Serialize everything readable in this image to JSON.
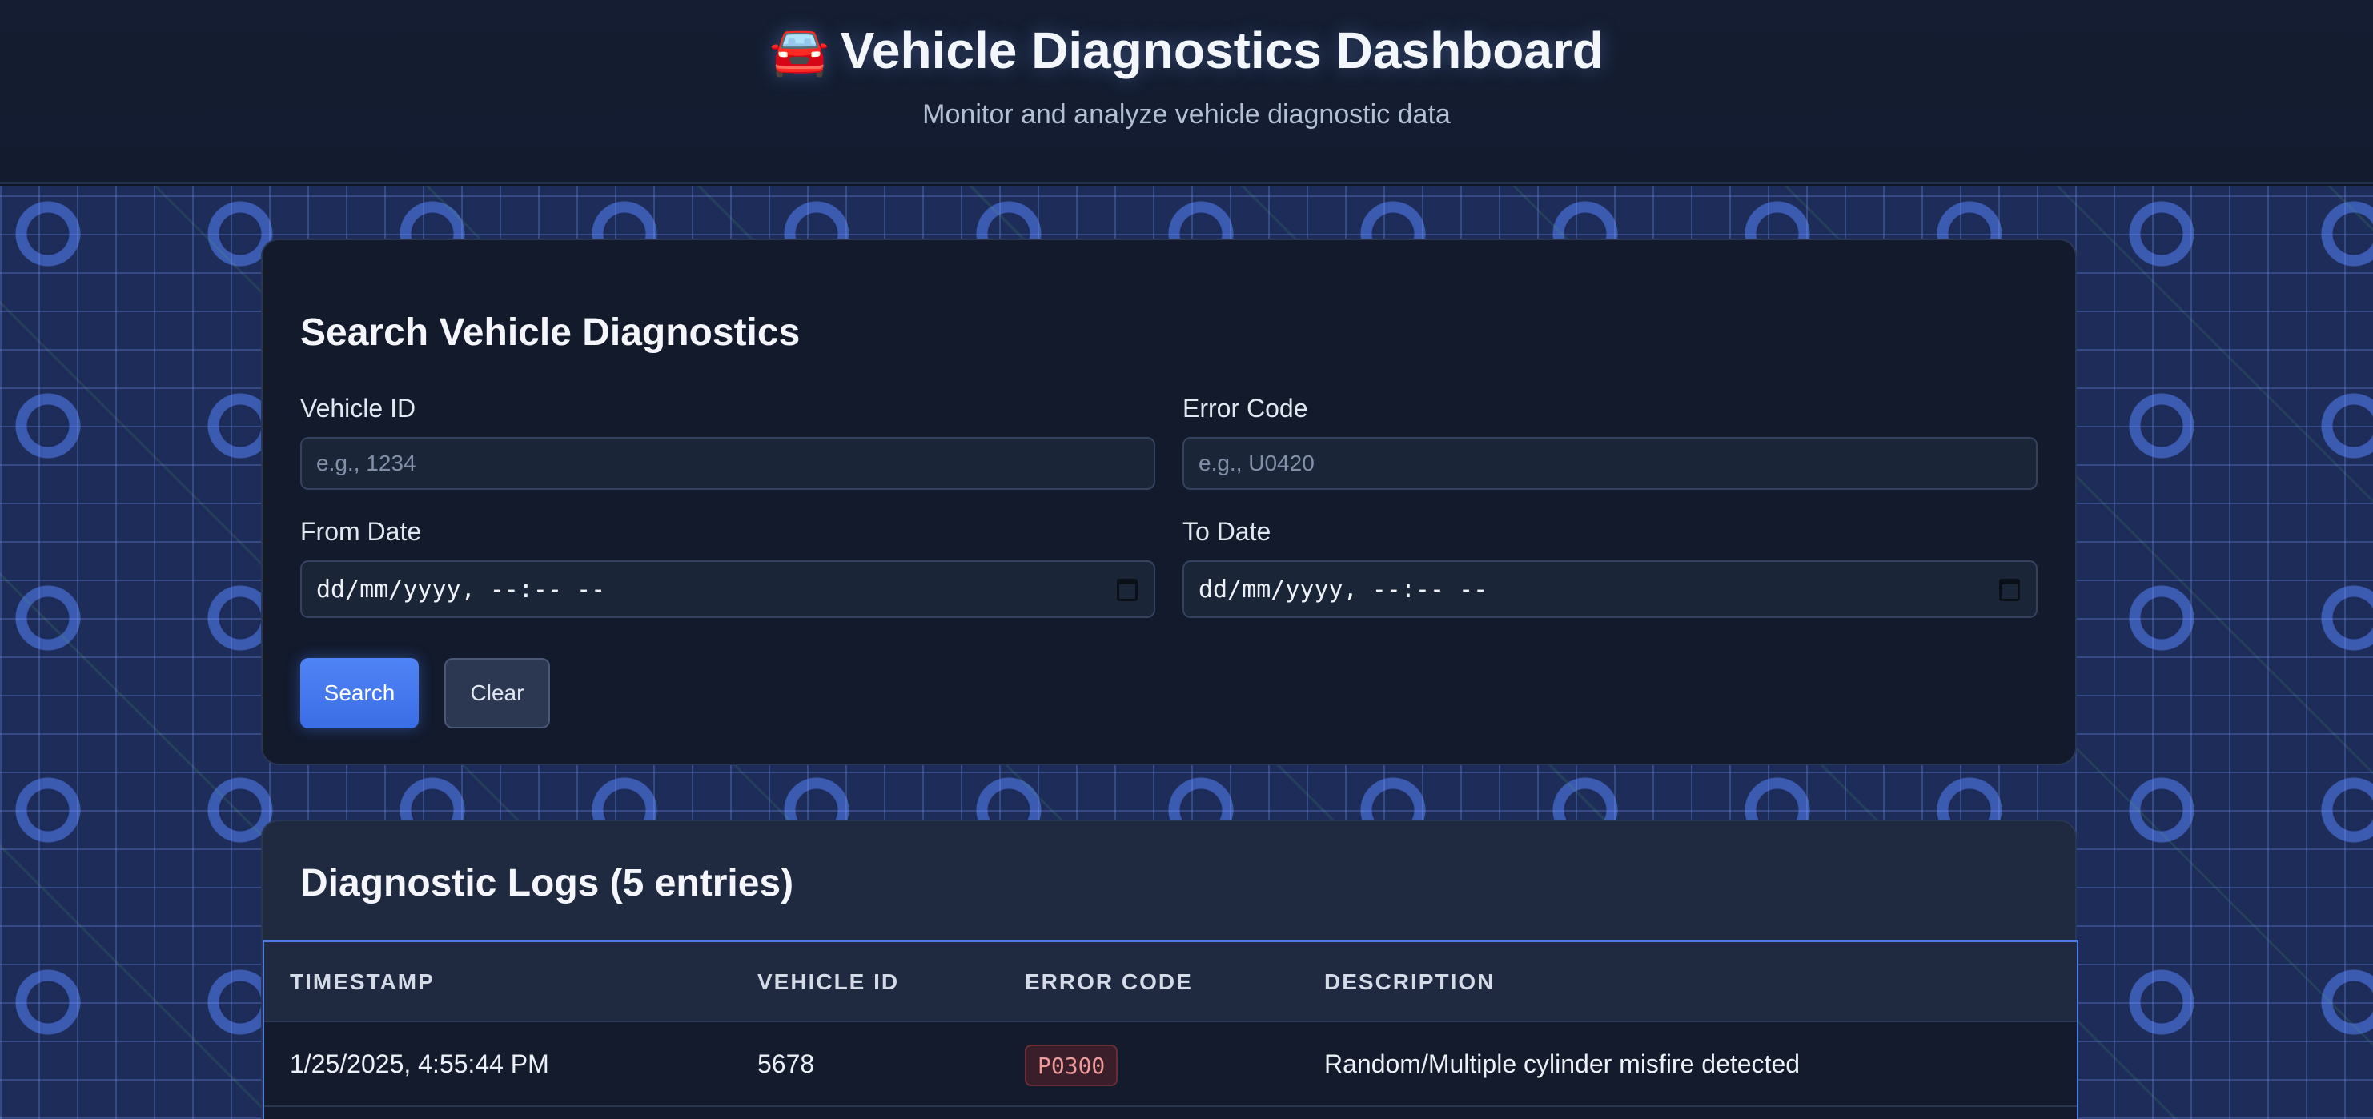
{
  "header": {
    "icon": "🚘",
    "title": "Vehicle Diagnostics Dashboard",
    "subtitle": "Monitor and analyze vehicle diagnostic data"
  },
  "search": {
    "title": "Search Vehicle Diagnostics",
    "vehicle_id_label": "Vehicle ID",
    "vehicle_id_placeholder": "e.g., 1234",
    "error_code_label": "Error Code",
    "error_code_placeholder": "e.g., U0420",
    "from_date_label": "From Date",
    "from_date_value": "dd/mm/yyyy, --:-- --",
    "to_date_label": "To Date",
    "to_date_value": "dd/mm/yyyy, --:-- --",
    "search_button": "Search",
    "clear_button": "Clear"
  },
  "logs": {
    "title": "Diagnostic Logs (5 entries)",
    "columns": [
      "TIMESTAMP",
      "VEHICLE ID",
      "ERROR CODE",
      "DESCRIPTION"
    ],
    "rows": [
      {
        "timestamp": "1/25/2025, 4:55:44 PM",
        "vehicle_id": "5678",
        "error_code": "P0300",
        "description": "Random/Multiple cylinder misfire detected"
      }
    ]
  },
  "colors": {
    "accent": "#3b6de6",
    "error_badge": "#f19a9a"
  }
}
